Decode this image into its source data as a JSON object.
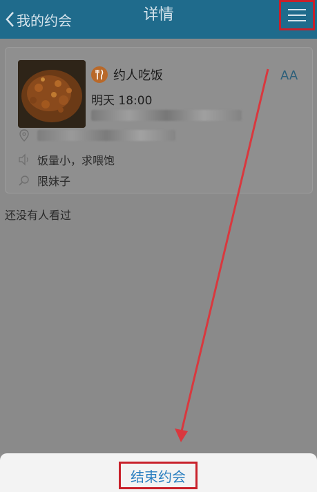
{
  "header": {
    "back_label": "我的约会",
    "title": "详情"
  },
  "event": {
    "category": "约人吃饭",
    "font_size_toggle": "AA",
    "time": "明天 18:00",
    "description": "饭量小，求喂饱",
    "restriction": "限妹子"
  },
  "views_text": "还没有人看过",
  "action": {
    "end_label": "结束约会"
  },
  "colors": {
    "header_bg": "#1f6b8c",
    "highlight": "#c8202a",
    "action_text": "#2a7fc0",
    "category_badge": "#b9692a"
  }
}
